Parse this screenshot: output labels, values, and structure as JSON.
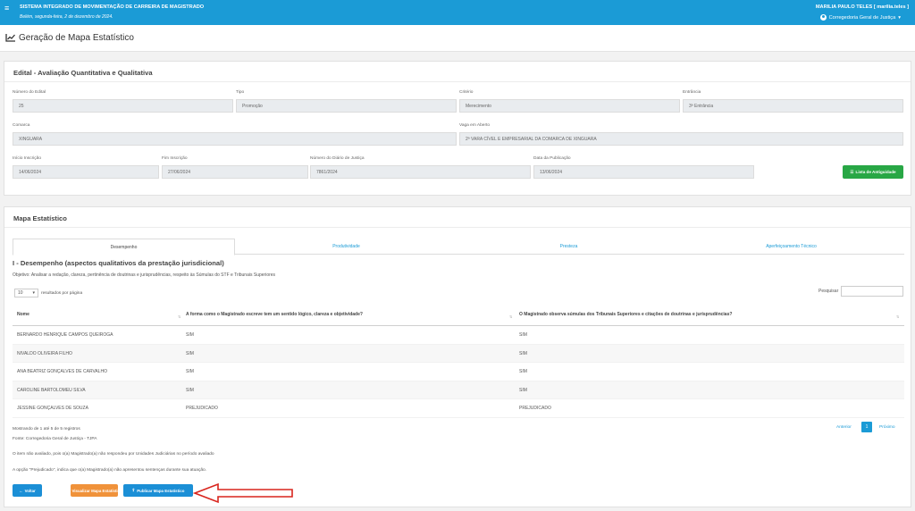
{
  "header": {
    "system_title": "SISTEMA INTEGRADO DE MOVIMENTAÇÃO DE CARREIRA DE MAGISTRADO",
    "date": "Belém, segunda-feira, 2 de dezembro de 2024.",
    "user": "MARILIA PAULO TELES [ marilia.teles ]",
    "org": "Corregedoria Geral de Justiça",
    "menu_icon": "hamburger-menu-icon",
    "user_icon": "user-circle-icon"
  },
  "page": {
    "title": "Geração de Mapa Estatístico",
    "icon": "line-chart-icon"
  },
  "edital": {
    "title": "Edital - Avaliação Quantitativa e Qualitativa",
    "fields": {
      "numero": {
        "label": "Número do Edital",
        "value": "25"
      },
      "tipo": {
        "label": "Tipo",
        "value": "Promoção"
      },
      "criterio": {
        "label": "Critério",
        "value": "Merecimento"
      },
      "entrancia": {
        "label": "Entrância",
        "value": "3ª Entrância"
      },
      "comarca": {
        "label": "Comarca",
        "value": "XINGUARA"
      },
      "vaga": {
        "label": "Vaga em Aberto",
        "value": "2ª VARA CÍVEL E EMPRESARIAL DA COMARCA DE XINGUARA"
      },
      "inicio": {
        "label": "Início Inscrição",
        "value": "14/06/2024"
      },
      "fim": {
        "label": "Fim Inscrição",
        "value": "27/06/2024"
      },
      "diario": {
        "label": "Número do Diário de Justiça",
        "value": "7861/2024"
      },
      "publicacao": {
        "label": "Data da Publicação",
        "value": "13/06/2024"
      }
    },
    "antiguidade_button": "Lista de Antiguidade"
  },
  "mapa": {
    "title": "Mapa Estatístico",
    "tabs": [
      {
        "label": "Desempenho",
        "active": true
      },
      {
        "label": "Produtividade",
        "active": false
      },
      {
        "label": "Presteza",
        "active": false
      },
      {
        "label": "Aperfeiçoamento Técnico",
        "active": false
      }
    ],
    "section_heading": "I - Desempenho (aspectos qualitativos da prestação jurisdicional)",
    "objective": "Objetivo: Analisar a redação, clareza, pertinência de doutrinas e jurisprudências, respeito às Súmulas do STF e Tribunais Superiores",
    "page_length": "10",
    "page_length_suffix": "resultados por página",
    "search_label": "Pesquisar",
    "search_value": "",
    "columns": [
      "Nome",
      "A forma como o Magistrado escreve tem um sentido lógico, clareza e objetividade?",
      "O Magistrado observa súmulas dos Tribunais Superiores e citações de doutrinas e jurisprudências?"
    ],
    "rows": [
      [
        "BERNARDO HENRIQUE CAMPOS QUEIROGA",
        "SIM",
        "SIM"
      ],
      [
        "NIVALDO OLIVEIRA FILHO",
        "SIM",
        "SIM"
      ],
      [
        "ANA BEATRIZ GONÇALVES DE CARVALHO",
        "SIM",
        "SIM"
      ],
      [
        "CAROLINE BARTOLOMEU SILVA",
        "SIM",
        "SIM"
      ],
      [
        "JESSINE GONÇALVES DE SOUZA",
        "PREJUDICADO",
        "PREJUDICADO"
      ]
    ],
    "info": "Mostrando de 1 até 5 de 5 registros",
    "fonte": "Fonte: Corregedoria Geral de Justiça - TJPA",
    "note1": "O item não avaliado, pois o(a) Magistrado(a) não respondeu por Unidades Judiciárias no período avaliado",
    "note2": "A opção \"Prejudicado\", indica que o(a) Magistrado(a) não apresentou sentenças durante sua atuação.",
    "pagination": {
      "prev": "Anterior",
      "current": "1",
      "next": "Próximo"
    },
    "buttons": {
      "back": "Voltar",
      "view": "Visualizar Mapa Estatístico",
      "publish": "Publicar Mapa Estatístico"
    }
  },
  "colors": {
    "topbar": "#1b9bd6",
    "primary": "#1b8fd6",
    "success": "#28a745",
    "warning": "#f0923a",
    "annotation_arrow": "#d9251d"
  }
}
